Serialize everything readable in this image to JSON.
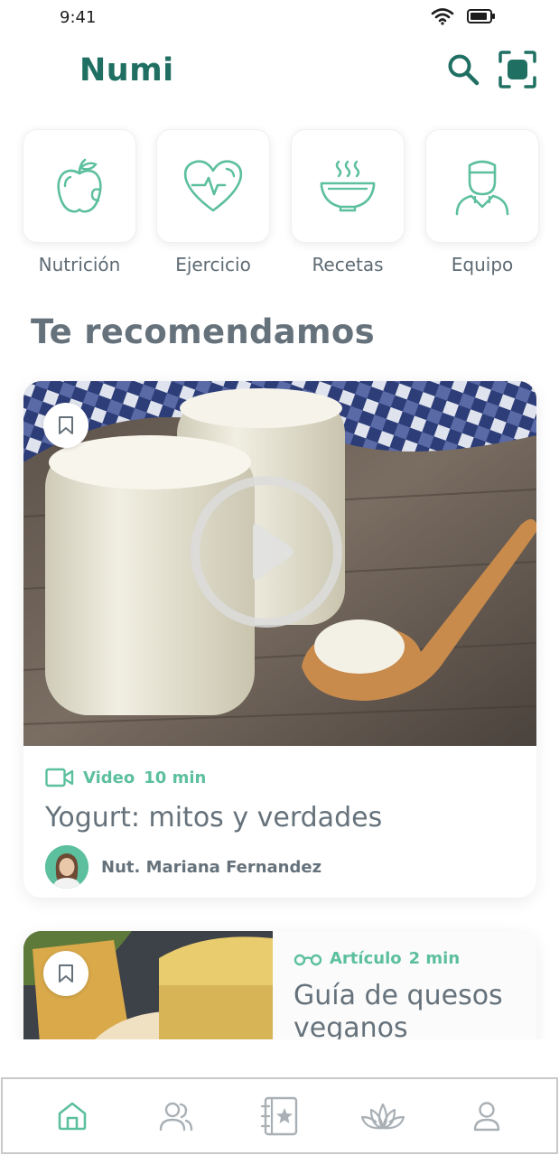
{
  "status_bar": {
    "time": "9:41"
  },
  "header": {
    "app_name": "Numi"
  },
  "categories": [
    {
      "label": "Nutrición",
      "icon": "apple-icon"
    },
    {
      "label": "Ejercicio",
      "icon": "heart-pulse-icon"
    },
    {
      "label": "Recetas",
      "icon": "bowl-icon"
    },
    {
      "label": "Equipo",
      "icon": "doctor-icon"
    }
  ],
  "recommended": {
    "title": "Te recomendamos",
    "featured": {
      "type_label": "Video",
      "duration": "10 min",
      "title": "Yogurt: mitos y verdades",
      "author": "Nut. Mariana Fernandez"
    },
    "article": {
      "type_label": "Artículo",
      "duration": "2 min",
      "title": "Guía de quesos veganos"
    }
  },
  "bottom_nav": [
    {
      "icon": "home-icon",
      "active": true
    },
    {
      "icon": "community-icon",
      "active": false
    },
    {
      "icon": "favorites-book-icon",
      "active": false
    },
    {
      "icon": "lotus-icon",
      "active": false
    },
    {
      "icon": "profile-icon",
      "active": false
    }
  ],
  "colors": {
    "primary": "#1f6f62",
    "accent": "#5cbf9d",
    "text": "#66727b",
    "icon_inactive": "#a9b0b5"
  }
}
